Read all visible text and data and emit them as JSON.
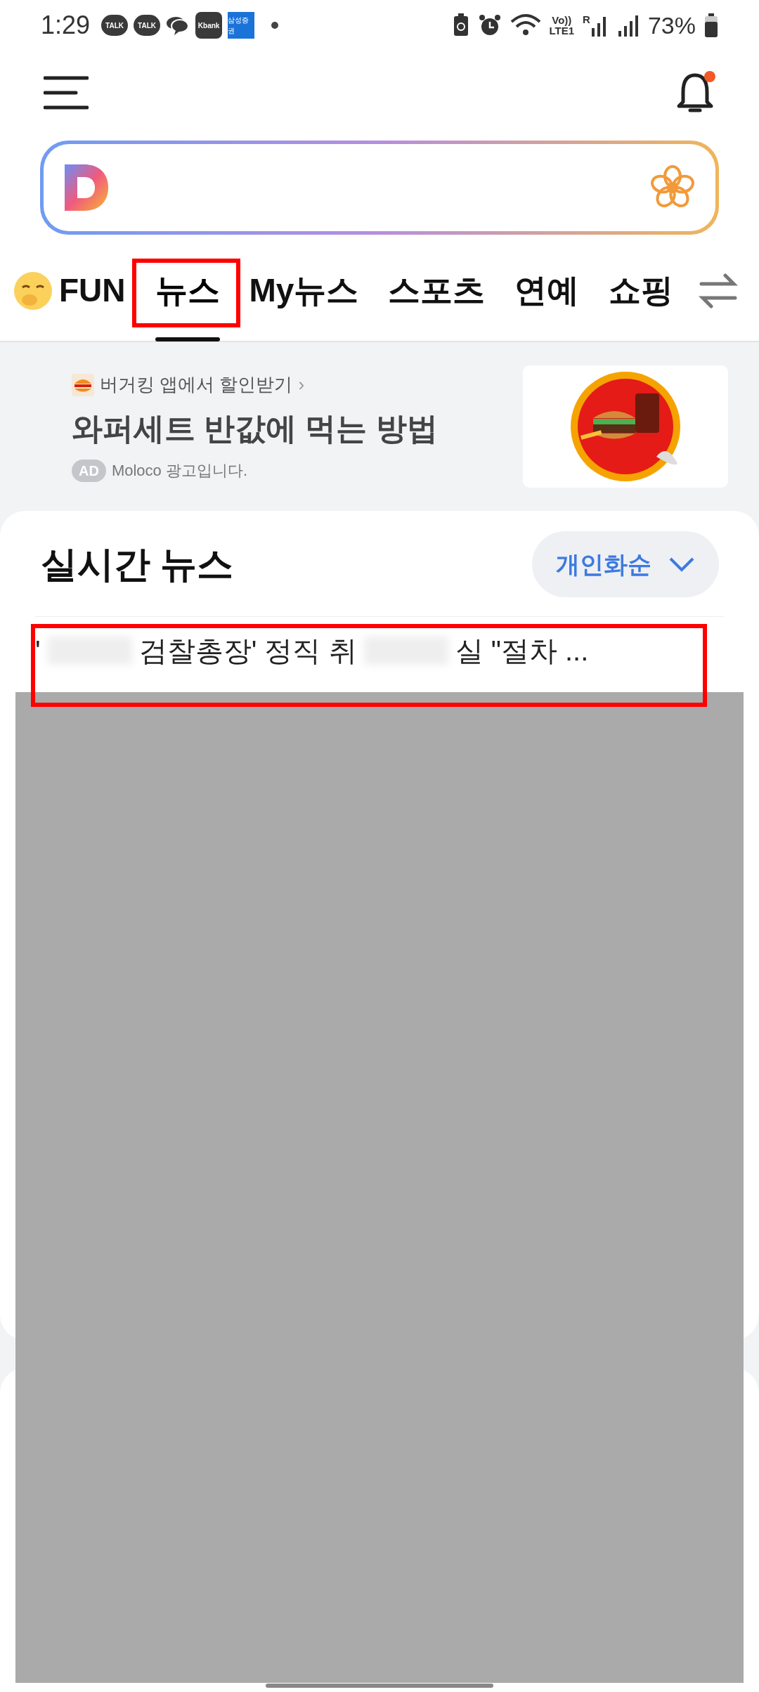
{
  "status_bar": {
    "time": "1:29",
    "notification_icons": [
      {
        "kind": "talk",
        "label": "TALK"
      },
      {
        "kind": "talk",
        "label": "TALK"
      },
      {
        "kind": "chat"
      },
      {
        "kind": "bank",
        "label": "Kbank"
      },
      {
        "kind": "brokerage",
        "label": "삼성증권"
      },
      {
        "kind": "dot"
      }
    ],
    "volte": "Vo))",
    "lte": "LTE1",
    "roaming": "R",
    "battery": "73%"
  },
  "header": {
    "notification_badge": true
  },
  "tabs": [
    {
      "label": "FUN",
      "selected": false,
      "emoji": true
    },
    {
      "label": "뉴스",
      "selected": true,
      "emoji": false
    },
    {
      "label": "My뉴스",
      "selected": false,
      "emoji": false
    },
    {
      "label": "스포츠",
      "selected": false,
      "emoji": false
    },
    {
      "label": "연예",
      "selected": false,
      "emoji": false
    },
    {
      "label": "쇼핑",
      "selected": false,
      "emoji": false
    }
  ],
  "ad": {
    "source": "버거킹 앱에서 할인받기",
    "source_chevron": "›",
    "headline": "와퍼세트 반값에 먹는 방법",
    "badge": "AD",
    "advertiser": "Moloco 광고입니다."
  },
  "realtime": {
    "title": "실시간 뉴스",
    "sort": "개인화순",
    "headline_parts": [
      "'",
      "검찰총장' 정직 취",
      "실 \"절차 ..."
    ]
  }
}
